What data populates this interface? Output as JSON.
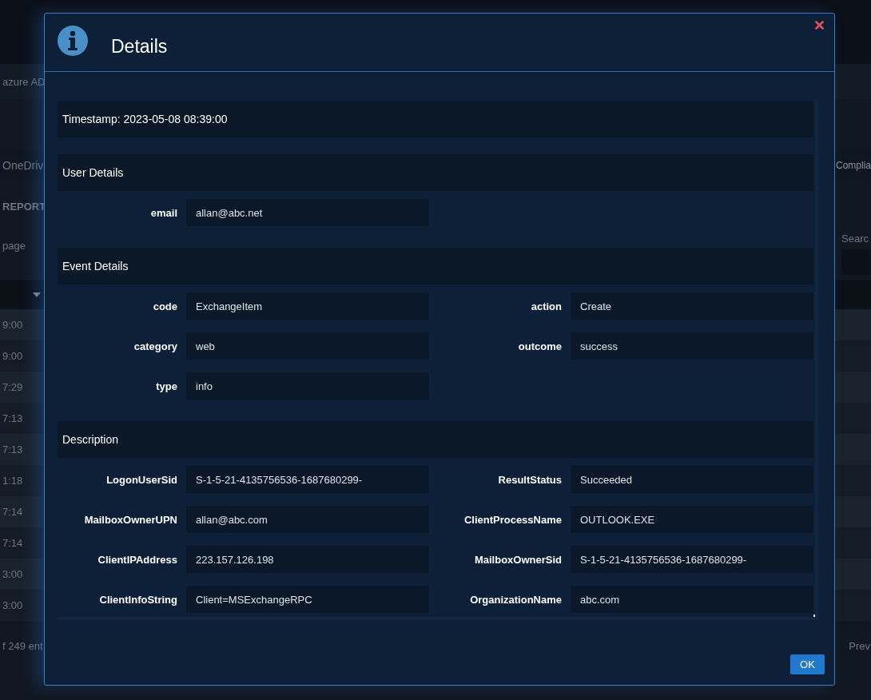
{
  "background": {
    "notice": "azure AD",
    "nav_left": "OneDriv",
    "nav_right": "Complia",
    "report_title": "REPORT",
    "page_length": "page",
    "search_label": "Searc",
    "entries_info": "f 249 ent",
    "pager": "Prev",
    "times": [
      "9:00",
      "9:00",
      "7:29",
      "7:13",
      "7:13",
      "1:18",
      "7:14",
      "7:14",
      "3:00",
      "3:00"
    ]
  },
  "dialog": {
    "title": "Details",
    "timestamp": "Timestamp: 2023-05-08 08:39:00",
    "sections": [
      {
        "title": "User Details",
        "fields": [
          {
            "label": "email",
            "value": "allan@abc.net"
          }
        ]
      },
      {
        "title": "Event Details",
        "fields": [
          {
            "label": "code",
            "value": "ExchangeItem"
          },
          {
            "label": "action",
            "value": "Create"
          },
          {
            "label": "category",
            "value": "web"
          },
          {
            "label": "outcome",
            "value": "success"
          },
          {
            "label": "type",
            "value": "info"
          }
        ]
      },
      {
        "title": "Description",
        "fields": [
          {
            "label": "LogonUserSid",
            "value": "S-1-5-21-4135756536-1687680299-"
          },
          {
            "label": "ResultStatus",
            "value": "Succeeded"
          },
          {
            "label": "MailboxOwnerUPN",
            "value": "allan@abc.com"
          },
          {
            "label": "ClientProcessName",
            "value": "OUTLOOK.EXE"
          },
          {
            "label": "ClientIPAddress",
            "value": "223.157.126.198"
          },
          {
            "label": "MailboxOwnerSid",
            "value": "S-1-5-21-4135756536-1687680299-"
          },
          {
            "label": "ClientInfoString",
            "value": "Client=MSExchangeRPC"
          },
          {
            "label": "OrganizationName",
            "value": "abc.com"
          }
        ]
      }
    ],
    "ok_button": "OK"
  }
}
